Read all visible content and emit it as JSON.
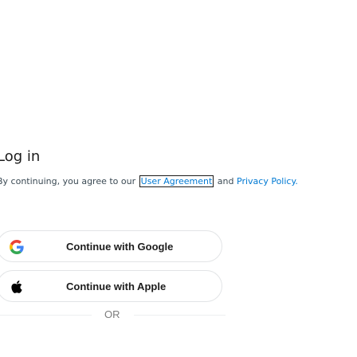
{
  "login": {
    "title": "Log in",
    "agreement_prefix": "By continuing, you agree to our",
    "agreement_link": "User Agreement",
    "agreement_suffix": " and ",
    "privacy_link": "Privacy Policy."
  },
  "sso": {
    "google_label": "Continue with Google",
    "apple_label": "Continue with Apple",
    "google_icon": "google-icon",
    "apple_icon": "apple-icon"
  },
  "divider": {
    "label": "OR"
  },
  "colors": {
    "link": "#0079d3",
    "text": "#1c1c1c",
    "border": "#e2e4e6"
  }
}
